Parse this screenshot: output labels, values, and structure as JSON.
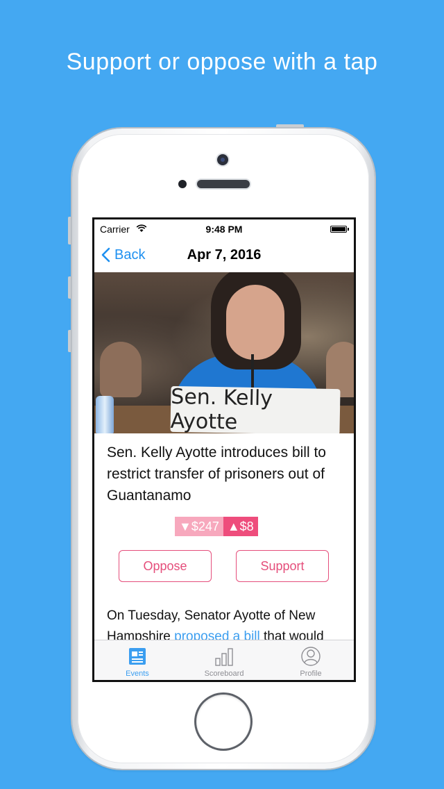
{
  "headline": "Support or oppose with a tap",
  "status_bar": {
    "carrier": "Carrier",
    "time": "9:48 PM"
  },
  "nav": {
    "back_label": "Back",
    "title": "Apr 7, 2016"
  },
  "hero": {
    "placard_text": "Sen. Kelly Ayotte"
  },
  "article": {
    "title": "Sen. Kelly Ayotte introduces bill to restrict transfer of prisoners out of Guantanamo",
    "tally_oppose": "▼$247",
    "tally_support": "▲$8",
    "oppose_label": "Oppose",
    "support_label": "Support",
    "body_start": "On Tuesday, Senator Ayotte of New Hampshire ",
    "body_link": "proposed a bill",
    "body_end": " that would"
  },
  "tabs": [
    {
      "label": "Events",
      "icon": "newspaper-icon",
      "active": true
    },
    {
      "label": "Scoreboard",
      "icon": "bar-chart-icon",
      "active": false
    },
    {
      "label": "Profile",
      "icon": "person-icon",
      "active": false
    }
  ],
  "colors": {
    "background": "#44a8f2",
    "accent": "#e54e7b",
    "link": "#3b9ef0",
    "tally_oppose": "#f7a8bd",
    "tally_support": "#ee4d7c"
  }
}
